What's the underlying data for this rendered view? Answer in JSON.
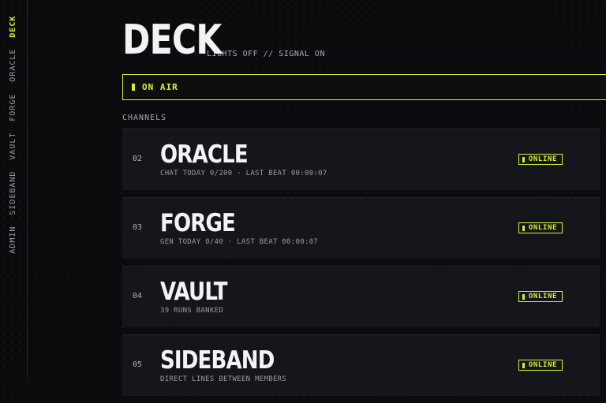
{
  "sidebar": {
    "items": [
      {
        "label": "DECK",
        "active": true
      },
      {
        "label": "ORACLE",
        "active": false
      },
      {
        "label": "FORGE",
        "active": false
      },
      {
        "label": "VAULT",
        "active": false
      },
      {
        "label": "SIDEBAND",
        "active": false
      },
      {
        "label": "ADMIN",
        "active": false
      }
    ]
  },
  "header": {
    "title": "DECK",
    "subtitle": "LIGHTS OFF // SIGNAL ON"
  },
  "status_bar": {
    "label": "ON AIR"
  },
  "channels": {
    "section_label": "CHANNELS",
    "items": [
      {
        "number": "02",
        "name": "ORACLE",
        "meta": "CHAT TODAY 0/200 · LAST BEAT 00:00:07",
        "status": "ONLINE"
      },
      {
        "number": "03",
        "name": "FORGE",
        "meta": "GEN TODAY 0/40 · LAST BEAT 00:00:07",
        "status": "ONLINE"
      },
      {
        "number": "04",
        "name": "VAULT",
        "meta": "39 RUNS BANKED",
        "status": "ONLINE"
      },
      {
        "number": "05",
        "name": "SIDEBAND",
        "meta": "DIRECT LINES BETWEEN MEMBERS",
        "status": "ONLINE"
      }
    ]
  },
  "colors": {
    "accent": "#d4f036",
    "background": "#0b0b0e",
    "card": "#15161c"
  }
}
